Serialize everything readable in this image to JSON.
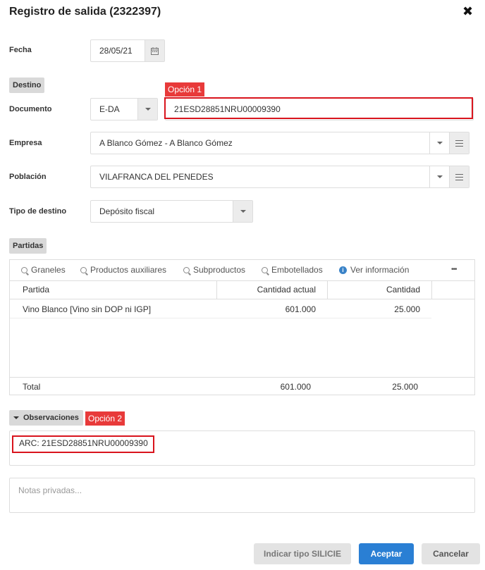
{
  "dialog": {
    "title": "Registro de salida (2322397)",
    "close_icon": "✖"
  },
  "fecha": {
    "label": "Fecha",
    "value": "28/05/21",
    "icon": "calendar-icon"
  },
  "destino": {
    "section_label": "Destino",
    "documento": {
      "label": "Documento",
      "type_value": "E-DA",
      "number_value": "21ESD28851NRU00009390",
      "annotation": "Opción 1"
    },
    "empresa": {
      "label": "Empresa",
      "value": "A Blanco Gómez - A Blanco Gómez"
    },
    "poblacion": {
      "label": "Población",
      "value": "VILAFRANCA DEL PENEDES"
    },
    "tipo_destino": {
      "label": "Tipo de destino",
      "value": "Depósito fiscal"
    }
  },
  "partidas": {
    "section_label": "Partidas",
    "toolbar": {
      "graneles": "Graneles",
      "productos": "Productos auxiliares",
      "subproductos": "Subproductos",
      "embotellados": "Embotellados",
      "ver_info": "Ver información",
      "more": "•••"
    },
    "columns": [
      "Partida",
      "Cantidad actual",
      "Cantidad"
    ],
    "rows": [
      {
        "partida": "Vino Blanco [Vino sin DOP ni IGP]",
        "cantidad_actual": "601.000",
        "cantidad": "25.000"
      }
    ],
    "total": {
      "label": "Total",
      "cantidad_actual": "601.000",
      "cantidad": "25.000"
    }
  },
  "observaciones": {
    "section_label": "Observaciones",
    "annotation": "Opción 2",
    "value": "ARC: 21ESD28851NRU00009390"
  },
  "notas": {
    "placeholder": "Notas privadas..."
  },
  "footer": {
    "silicie_label": "Indicar tipo SILICIE",
    "accept_label": "Aceptar",
    "cancel_label": "Cancelar"
  },
  "colors": {
    "accent": "#2a7fd4",
    "annotation_red": "#e83a3a",
    "box_red": "#d9141d"
  }
}
